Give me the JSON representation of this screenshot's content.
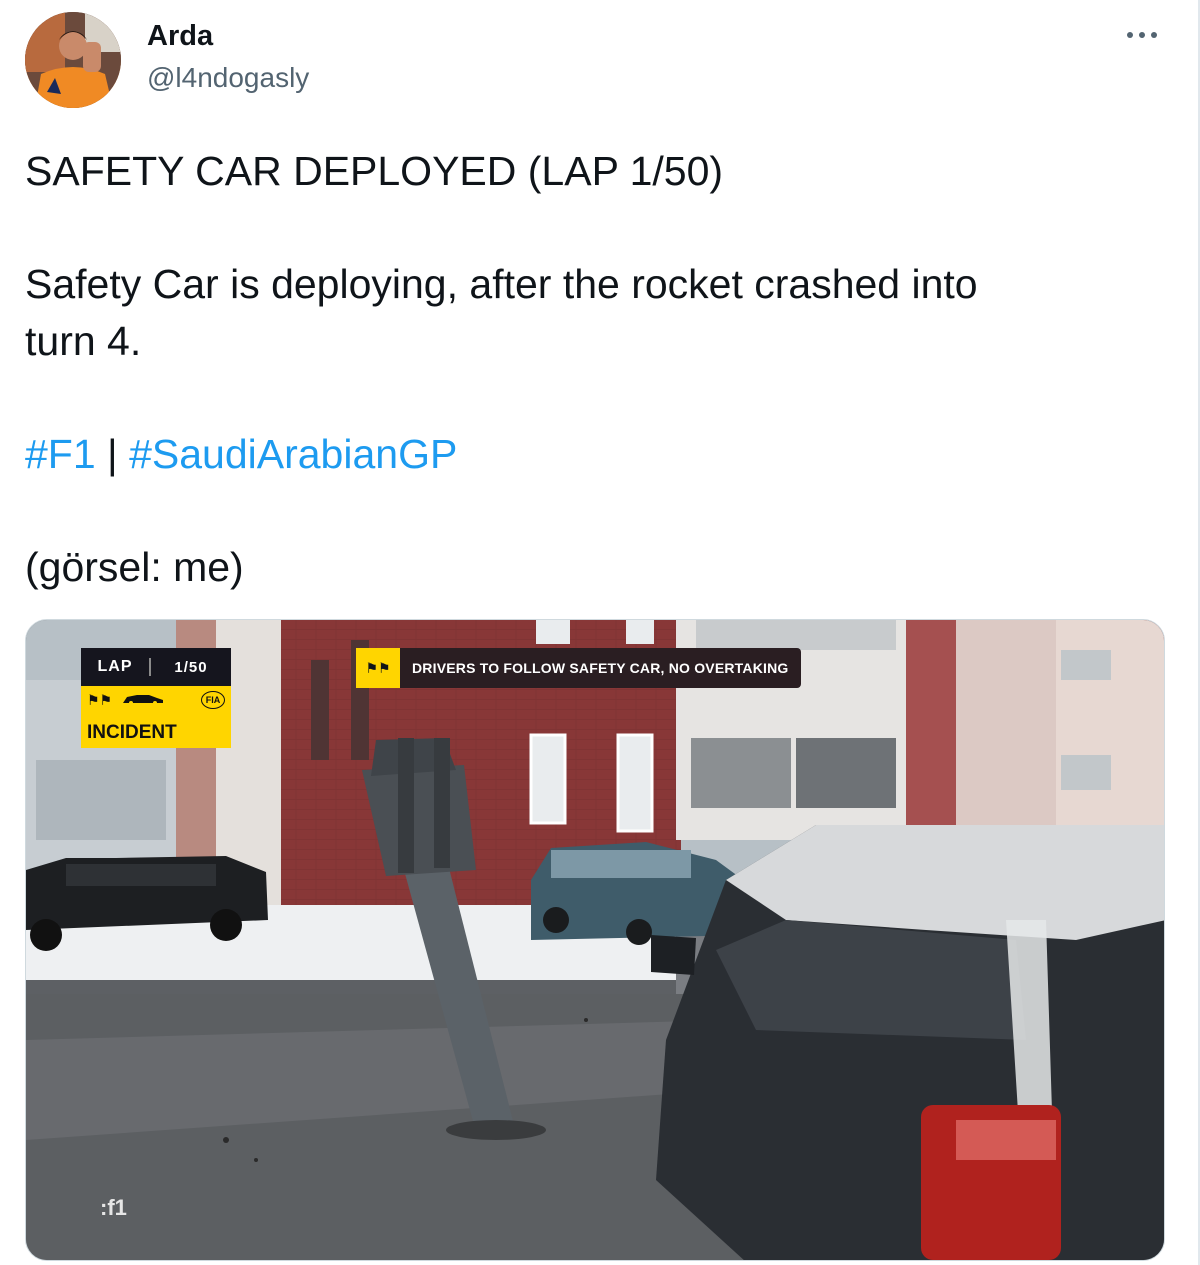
{
  "user": {
    "display_name": "Arda",
    "handle": "@l4ndogasly",
    "avatar_icon": "user-avatar"
  },
  "menu_icon": "more-icon",
  "tweet": {
    "line1": "SAFETY CAR DEPLOYED (LAP 1/50)",
    "line2": "Safety Car is deploying, after the rocket crashed into",
    "line3": "turn 4.",
    "hashtag1": "#F1",
    "separator": " | ",
    "hashtag2": "#SaudiArabianGP",
    "line5": "(görsel: me)"
  },
  "media": {
    "lap_label": "LAP",
    "lap_value": "1/50",
    "fia_label": "FIA",
    "incident_label": "INCIDENT",
    "message": "DRIVERS TO FOLLOW SAFETY CAR, NO OVERTAKING",
    "watermark": ":f1"
  },
  "colors": {
    "link": "#1d9bf0",
    "f1_yellow": "#ffd500",
    "f1_dark": "#15151e"
  }
}
